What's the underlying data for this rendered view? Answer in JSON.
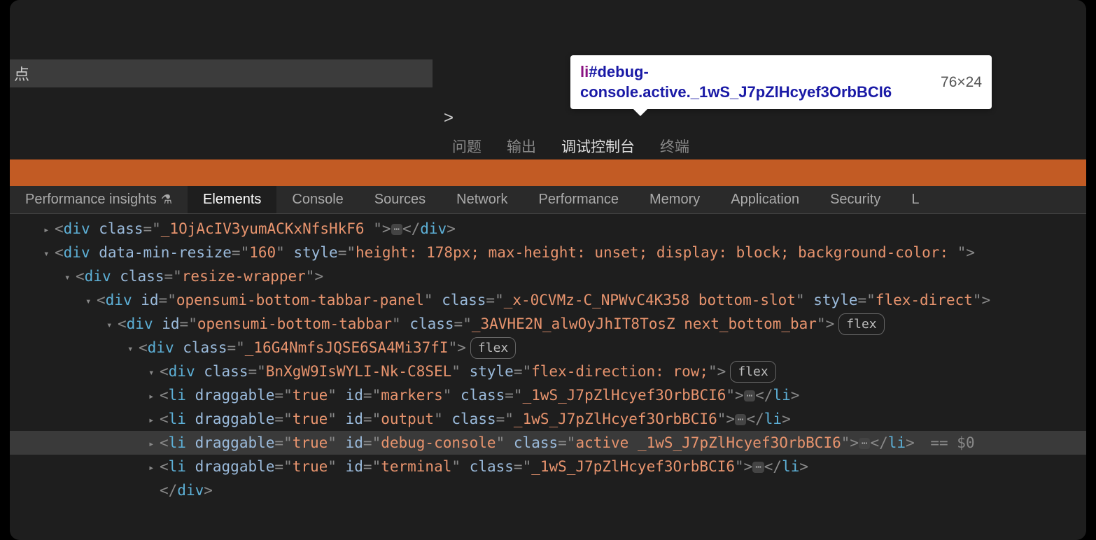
{
  "top": {
    "search_placeholder": "点",
    "prompt": ">"
  },
  "panel_tabs": [
    {
      "label": "问题",
      "active": false
    },
    {
      "label": "输出",
      "active": false
    },
    {
      "label": "调试控制台",
      "active": true
    },
    {
      "label": "终端",
      "active": false
    }
  ],
  "inspect_tooltip": {
    "tag": "li",
    "id": "#debug-console",
    "classes": ".active._1wS_J7pZlHcyef3OrbBCI6",
    "dimensions": "76×24"
  },
  "devtools_tabs": [
    {
      "label": "Performance insights",
      "icon": "flask",
      "active": false
    },
    {
      "label": "Elements",
      "active": true
    },
    {
      "label": "Console",
      "active": false
    },
    {
      "label": "Sources",
      "active": false
    },
    {
      "label": "Network",
      "active": false
    },
    {
      "label": "Performance",
      "active": false
    },
    {
      "label": "Memory",
      "active": false
    },
    {
      "label": "Application",
      "active": false
    },
    {
      "label": "Security",
      "active": false
    },
    {
      "label": "L",
      "active": false
    }
  ],
  "dom": [
    {
      "indent": 1,
      "tri": "▸",
      "open_tag": "div",
      "attrs": [
        [
          "class",
          "_1OjAcIV3yumACKxNfsHkF6 "
        ]
      ],
      "ellipsis": true,
      "close_tag": "div"
    },
    {
      "indent": 1,
      "tri": "▾",
      "open_tag": "div",
      "attrs": [
        [
          "data-min-resize",
          "160"
        ],
        [
          "style",
          "height: 178px; max-height: unset; display: block; background-color: "
        ]
      ]
    },
    {
      "indent": 2,
      "tri": "▾",
      "open_tag": "div",
      "attrs": [
        [
          "class",
          "resize-wrapper"
        ]
      ]
    },
    {
      "indent": 3,
      "tri": "▾",
      "open_tag": "div",
      "attrs": [
        [
          "id",
          "opensumi-bottom-tabbar-panel"
        ],
        [
          "class",
          "_x-0CVMz-C_NPWvC4K358 bottom-slot"
        ],
        [
          "style",
          "flex-direct"
        ]
      ]
    },
    {
      "indent": 4,
      "tri": "▾",
      "open_tag": "div",
      "attrs": [
        [
          "id",
          "opensumi-bottom-tabbar"
        ],
        [
          "class",
          "_3AVHE2N_alwOyJhIT8TosZ next_bottom_bar"
        ]
      ],
      "badge": "flex"
    },
    {
      "indent": 5,
      "tri": "▾",
      "open_tag": "div",
      "attrs": [
        [
          "class",
          "_16G4NmfsJQSE6SA4Mi37fI"
        ]
      ],
      "badge": "flex"
    },
    {
      "indent": 6,
      "tri": "▾",
      "open_tag": "div",
      "attrs": [
        [
          "class",
          "BnXgW9IsWYLI-Nk-C8SEL"
        ],
        [
          "style",
          "flex-direction: row;"
        ]
      ],
      "badge": "flex"
    },
    {
      "indent": 7,
      "tri": "▸",
      "open_tag": "li",
      "attrs": [
        [
          "draggable",
          "true"
        ],
        [
          "id",
          "markers"
        ],
        [
          "class",
          "_1wS_J7pZlHcyef3OrbBCI6"
        ]
      ],
      "ellipsis": true,
      "close_tag": "li"
    },
    {
      "indent": 7,
      "tri": "▸",
      "open_tag": "li",
      "attrs": [
        [
          "draggable",
          "true"
        ],
        [
          "id",
          "output"
        ],
        [
          "class",
          "_1wS_J7pZlHcyef3OrbBCI6"
        ]
      ],
      "ellipsis": true,
      "close_tag": "li"
    },
    {
      "indent": 7,
      "tri": "▸",
      "open_tag": "li",
      "attrs": [
        [
          "draggable",
          "true"
        ],
        [
          "id",
          "debug-console"
        ],
        [
          "class",
          "active _1wS_J7pZlHcyef3OrbBCI6"
        ]
      ],
      "ellipsis": true,
      "close_tag": "li",
      "selected": true,
      "marker": " == $0"
    },
    {
      "indent": 7,
      "tri": "▸",
      "open_tag": "li",
      "attrs": [
        [
          "draggable",
          "true"
        ],
        [
          "id",
          "terminal"
        ],
        [
          "class",
          "_1wS_J7pZlHcyef3OrbBCI6"
        ]
      ],
      "ellipsis": true,
      "close_tag": "li"
    },
    {
      "indent": 7,
      "close_only": "div"
    }
  ]
}
